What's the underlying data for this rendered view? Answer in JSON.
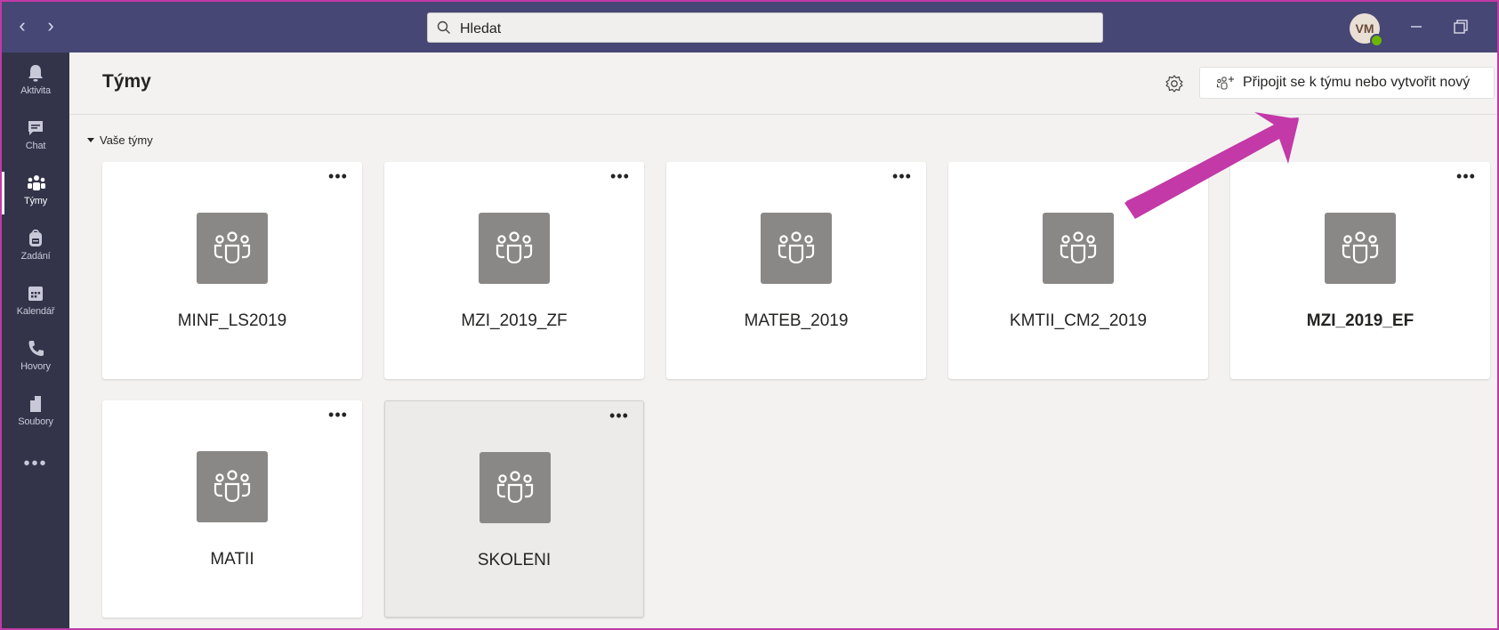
{
  "search": {
    "placeholder": "Hledat"
  },
  "user": {
    "initials": "VM"
  },
  "rail": [
    {
      "label": "Aktivita",
      "icon": "bell-icon"
    },
    {
      "label": "Chat",
      "icon": "chat-icon"
    },
    {
      "label": "Týmy",
      "icon": "teams-icon"
    },
    {
      "label": "Zadání",
      "icon": "backpack-icon"
    },
    {
      "label": "Kalendář",
      "icon": "calendar-icon"
    },
    {
      "label": "Hovory",
      "icon": "phone-icon"
    },
    {
      "label": "Soubory",
      "icon": "file-icon"
    }
  ],
  "header": {
    "title": "Týmy",
    "join_label": "Připojit se k týmu nebo vytvořit nový"
  },
  "section": {
    "label": "Vaše týmy"
  },
  "teams": [
    {
      "name": "MINF_LS2019"
    },
    {
      "name": "MZI_2019_ZF"
    },
    {
      "name": "MATEB_2019"
    },
    {
      "name": "KMTII_CM2_2019"
    },
    {
      "name": "MZI_2019_EF"
    },
    {
      "name": "MATII"
    },
    {
      "name": "SKOLENI"
    }
  ],
  "colors": {
    "titlebar": "#464775",
    "rail": "#33344a",
    "annotation": "#c239a7",
    "presence": "#6bb700"
  }
}
